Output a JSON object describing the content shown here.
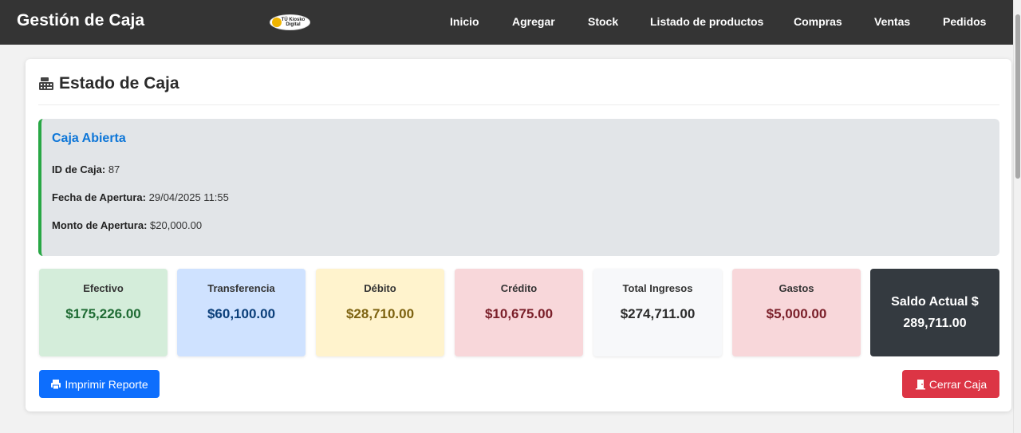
{
  "navbar": {
    "brand": "Gestión de Caja",
    "logo_text": "TÜ Kiosko\nDigital",
    "links": [
      "Inicio",
      "Agregar",
      "Stock",
      "Listado de productos",
      "Compras",
      "Ventas",
      "Pedidos"
    ]
  },
  "page": {
    "title": "Estado de Caja",
    "title_icon": "cash-register-icon"
  },
  "caja": {
    "status": "Caja Abierta",
    "id_label": "ID de Caja:",
    "id_value": "87",
    "fecha_label": "Fecha de Apertura:",
    "fecha_value": "29/04/2025 11:55",
    "monto_label": "Monto de Apertura:",
    "monto_value": "$20,000.00"
  },
  "stats": [
    {
      "label": "Efectivo",
      "value": "$175,226.00",
      "bg": "#d4edda",
      "color": "#1e6b33"
    },
    {
      "label": "Transferencia",
      "value": "$60,100.00",
      "bg": "#cfe2ff",
      "color": "#0b3f7a"
    },
    {
      "label": "Débito",
      "value": "$28,710.00",
      "bg": "#fff3cd",
      "color": "#7d6210"
    },
    {
      "label": "Crédito",
      "value": "$10,675.00",
      "bg": "#f8d7da",
      "color": "#7a1f29"
    },
    {
      "label": "Total Ingresos",
      "value": "$274,711.00",
      "bg": "#f7f8fa",
      "color": "#2b2b2b"
    },
    {
      "label": "Gastos",
      "value": "$5,000.00",
      "bg": "#f8d7da",
      "color": "#7a1f29"
    }
  ],
  "saldo": {
    "label": "Saldo Actual $",
    "value": "289,711.00"
  },
  "actions": {
    "print_label": "Imprimir Reporte",
    "print_icon": "printer-icon",
    "close_label": "Cerrar Caja",
    "close_icon": "door-icon"
  },
  "colors": {
    "navbar": "#343434",
    "accent_blue": "#0d6efd",
    "accent_red": "#dc3545",
    "status_green": "#28a745"
  }
}
